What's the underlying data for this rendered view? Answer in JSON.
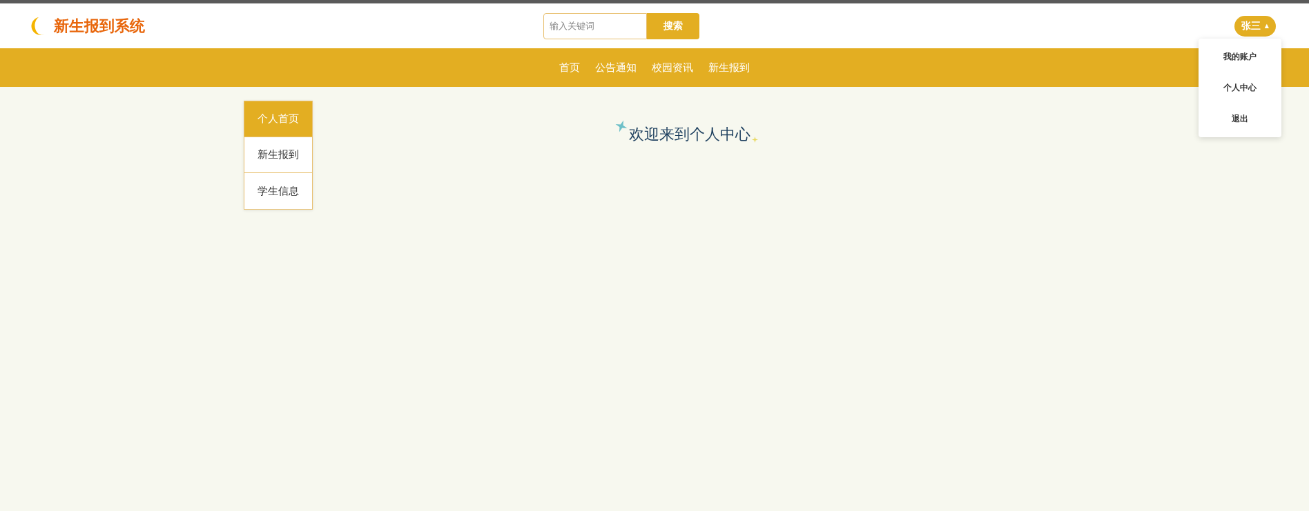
{
  "header": {
    "logo_text": "新生报到系统",
    "search": {
      "placeholder": "输入关键词",
      "button": "搜索"
    },
    "user": {
      "name": "张三",
      "caret": "▲",
      "menu_open": true,
      "menu": [
        "我的账户",
        "个人中心",
        "退出"
      ]
    }
  },
  "nav": [
    "首页",
    "公告通知",
    "校园资讯",
    "新生报到"
  ],
  "sidebar": [
    {
      "label": "个人首页",
      "selected": true
    },
    {
      "label": "新生报到",
      "selected": false
    },
    {
      "label": "学生信息",
      "selected": false
    }
  ],
  "welcome": "欢迎来到个人中心"
}
